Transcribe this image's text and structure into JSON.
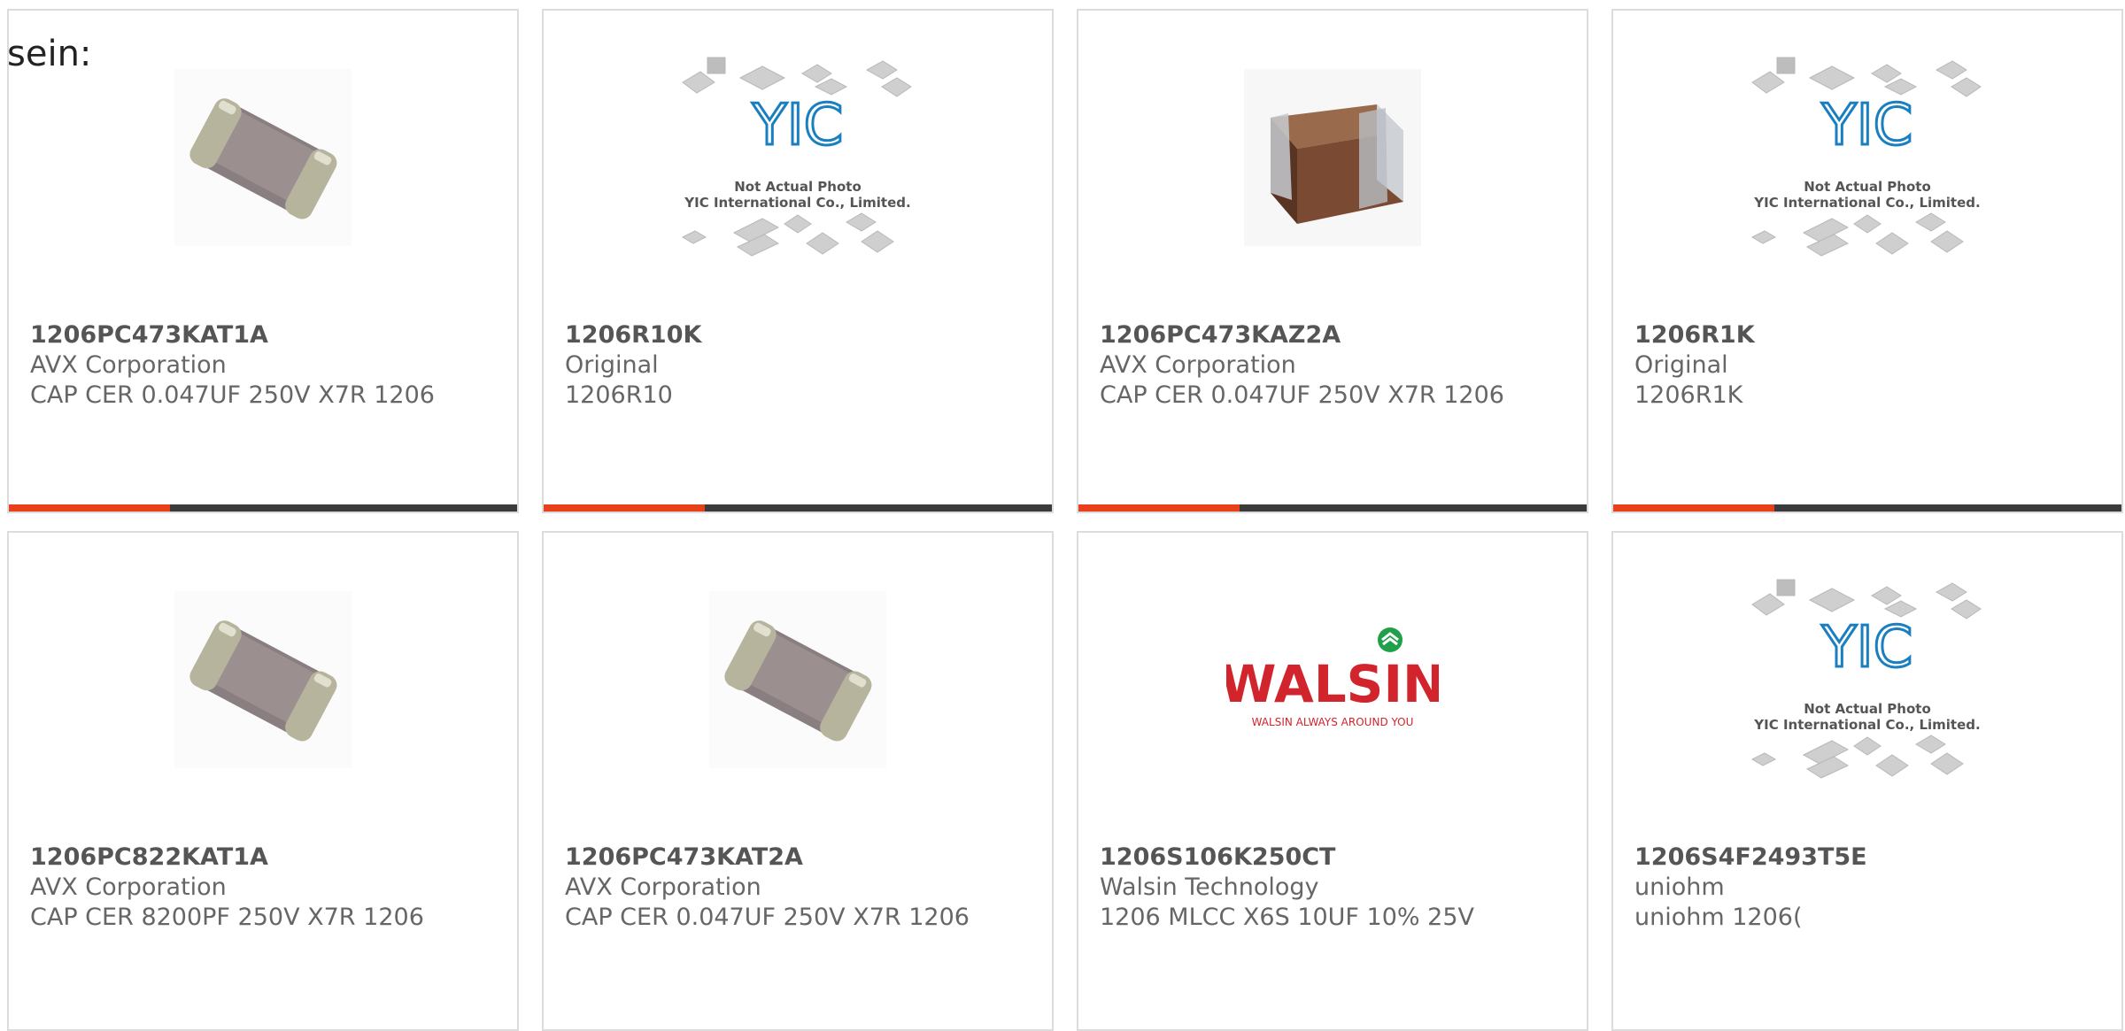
{
  "lead_text": "sein:",
  "colors": {
    "accent": "#e8401a",
    "bar": "#3b3b3b",
    "border": "#dcdcdc"
  },
  "products": [
    {
      "part": "1206PC473KAT1A",
      "maker": "AVX Corporation",
      "desc": "CAP CER 0.047UF 250V X7R 1206",
      "image": "ceramic-chip-icon"
    },
    {
      "part": "1206R10K",
      "maker": "Original",
      "desc": "1206R10",
      "image": "yic-placeholder",
      "logo_text": [
        "Not Actual Photo",
        "YIC International Co., Limited."
      ]
    },
    {
      "part": "1206PC473KAZ2A",
      "maker": "AVX Corporation",
      "desc": "CAP CER 0.047UF 250V X7R 1206",
      "image": "brown-capacitor-icon"
    },
    {
      "part": "1206R1K",
      "maker": "Original",
      "desc": "1206R1K",
      "image": "yic-placeholder",
      "logo_text": [
        "Not Actual Photo",
        "YIC International Co., Limited."
      ]
    },
    {
      "part": "1206PC822KAT1A",
      "maker": "AVX Corporation",
      "desc": "CAP CER 8200PF 250V X7R 1206",
      "image": "ceramic-chip-icon"
    },
    {
      "part": "1206PC473KAT2A",
      "maker": "AVX Corporation",
      "desc": "CAP CER 0.047UF 250V X7R 1206",
      "image": "ceramic-chip-icon"
    },
    {
      "part": "1206S106K250CT",
      "maker": "Walsin Technology",
      "desc": "1206 MLCC X6S 10UF 10% 25V",
      "image": "walsin-logo",
      "logo_text": [
        "WALSIN",
        "WALSIN ALWAYS AROUND YOU"
      ]
    },
    {
      "part": "1206S4F2493T5E",
      "maker": "uniohm",
      "desc": "uniohm 1206(",
      "image": "yic-placeholder",
      "logo_text": [
        "Not Actual Photo",
        "YIC International Co., Limited."
      ]
    }
  ]
}
